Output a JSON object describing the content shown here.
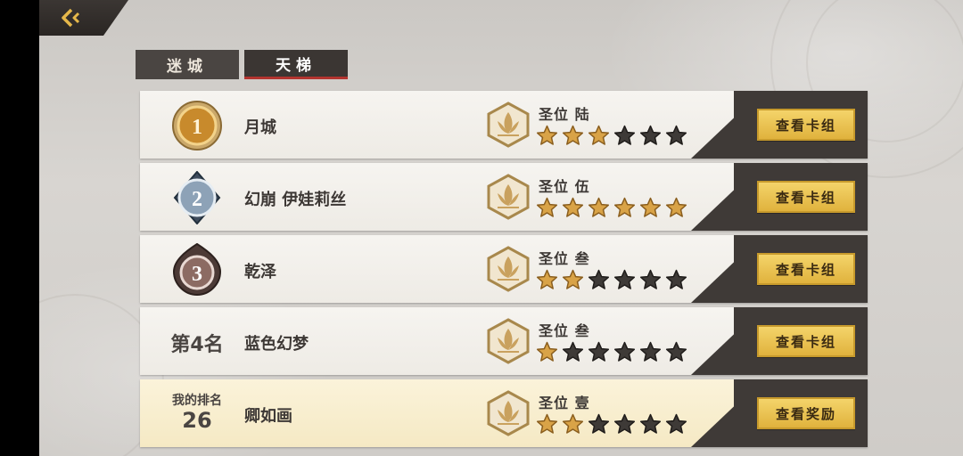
{
  "colors": {
    "accent_gold": "#e0b23d",
    "panel_dark": "#3f3a37",
    "star_filled": "#d9a347",
    "star_empty": "#3e3a37",
    "tab_active_underline": "#b3342f",
    "my_row_bg": "#fbf3da"
  },
  "back_button": {
    "icon": "back-arrow-icon"
  },
  "tabs": [
    {
      "label": "迷城",
      "active": false
    },
    {
      "label": "天梯",
      "active": true
    }
  ],
  "rows": [
    {
      "rank": "1",
      "rank_style": "gold-badge",
      "player": "月城",
      "tier": "圣位 陆",
      "stars_filled": 3,
      "stars_total": 6,
      "action": "查看卡组"
    },
    {
      "rank": "2",
      "rank_style": "silver-badge",
      "player": "幻崩 伊娃莉丝",
      "tier": "圣位 伍",
      "stars_filled": 6,
      "stars_total": 6,
      "action": "查看卡组"
    },
    {
      "rank": "3",
      "rank_style": "bronze-badge",
      "player": "乾泽",
      "tier": "圣位 叁",
      "stars_filled": 2,
      "stars_total": 6,
      "action": "查看卡组"
    },
    {
      "rank": "第4名",
      "rank_style": "text",
      "player": "蓝色幻梦",
      "tier": "圣位 叁",
      "stars_filled": 1,
      "stars_total": 6,
      "action": "查看卡组"
    }
  ],
  "my_row": {
    "rank_label": "我的排名",
    "rank_value": "26",
    "player": "卿如画",
    "tier": "圣位 壹",
    "stars_filled": 2,
    "stars_total": 6,
    "action": "查看奖励"
  }
}
